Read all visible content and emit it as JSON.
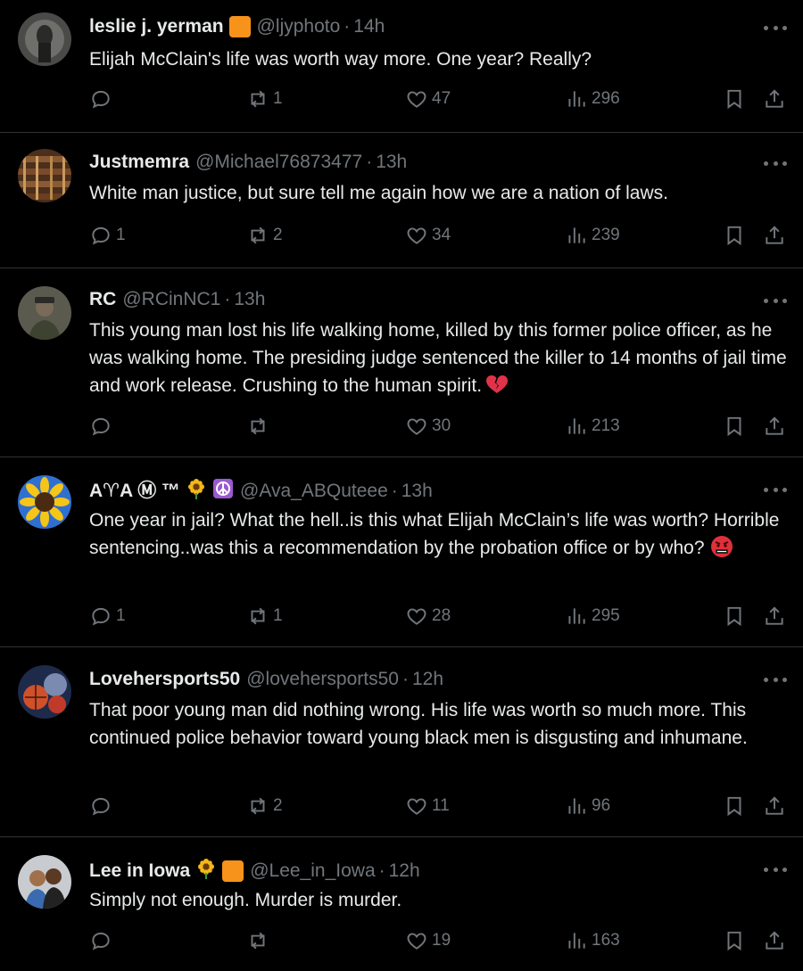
{
  "tweets": [
    {
      "name": "leslie j. yerman",
      "badges": [
        "orange-square"
      ],
      "handle": "@ljyphoto",
      "time": "14h",
      "text": "Elijah McClain's life was worth way more. One year? Really?",
      "replies": "",
      "retweets": "1",
      "likes": "47",
      "views": "296"
    },
    {
      "name": "Justmemra",
      "badges": [],
      "handle": "@Michael76873477",
      "time": "13h",
      "text": "White man justice, but sure tell me again how we are a nation of laws.",
      "replies": "1",
      "retweets": "2",
      "likes": "34",
      "views": "239"
    },
    {
      "name": "RC",
      "badges": [],
      "handle": "@RCinNC1",
      "time": "13h",
      "text": "This young man lost his life walking home, killed by this former police officer, as he was walking home.  The presiding judge sentenced the killer to 14 months of jail time and work release. Crushing to the human spirit.",
      "text_emoji": "broken-heart-icon",
      "replies": "",
      "retweets": "",
      "likes": "30",
      "views": "213"
    },
    {
      "name": "A♈A Ⓜ ™",
      "badges": [
        "sunflower",
        "peace"
      ],
      "handle": "@Ava_ABQuteee",
      "time": "13h",
      "text": "One year in jail? What the hell..is this what Elijah McClain’s life was worth? Horrible sentencing..was this a recommendation by the probation office or by who?",
      "text_emoji": "angry-face-icon",
      "replies": "1",
      "retweets": "1",
      "likes": "28",
      "views": "295"
    },
    {
      "name": "Lovehersports50",
      "badges": [],
      "handle": "@lovehersports50",
      "time": "12h",
      "text": "That poor young man did nothing wrong. His life was worth so much more. This continued police behavior toward young black men is disgusting and inhumane.",
      "replies": "",
      "retweets": "2",
      "likes": "11",
      "views": "96"
    },
    {
      "name": "Lee in Iowa",
      "badges": [
        "sunflower",
        "orange-square"
      ],
      "handle": "@Lee_in_Iowa",
      "time": "12h",
      "text": "Simply not enough. Murder is murder.",
      "replies": "",
      "retweets": "",
      "likes": "19",
      "views": "163"
    }
  ],
  "separator": "·",
  "colors": {
    "background": "#000000",
    "text": "#e7e9ea",
    "muted": "#71767b",
    "divider": "#2f3336",
    "badge": "#f7931a"
  }
}
